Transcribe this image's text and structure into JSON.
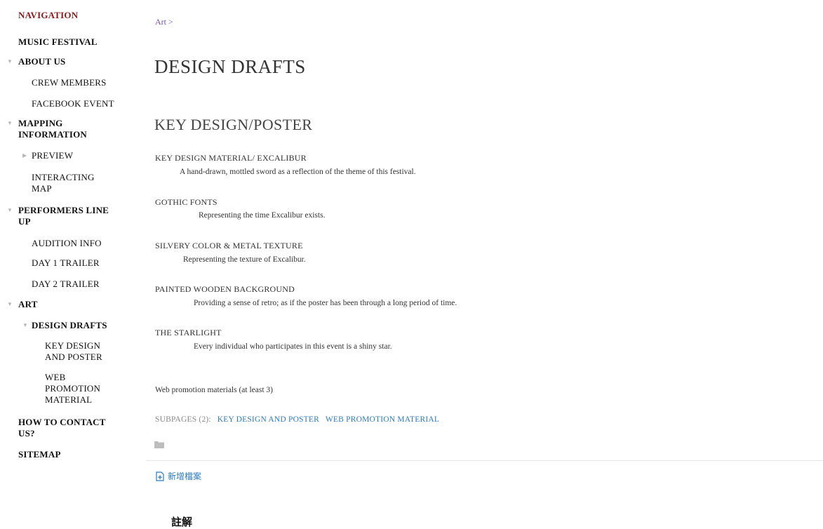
{
  "sidebar": {
    "heading": "NAVIGATION",
    "items": [
      {
        "label": "MUSIC FESTIVAL"
      },
      {
        "label": "ABOUT US"
      },
      {
        "label": "CREW MEMBERS"
      },
      {
        "label": "FACEBOOK EVENT"
      },
      {
        "label_line1": "MAPPING",
        "label_line2": "INFORMATION"
      },
      {
        "label": "PREVIEW"
      },
      {
        "label_line1": "INTERACTING",
        "label_line2": "MAP"
      },
      {
        "label_line1": "PERFORMERS LINE",
        "label_line2": "UP"
      },
      {
        "label": "AUDITION INFO"
      },
      {
        "label": "DAY 1 TRAILER"
      },
      {
        "label": "DAY 2 TRAILER"
      },
      {
        "label": "ART"
      },
      {
        "label": "DESIGN DRAFTS"
      },
      {
        "label_line1": "KEY DESIGN",
        "label_line2": "AND POSTER"
      },
      {
        "label_line1": "WEB",
        "label_line2": "PROMOTION",
        "label_line3": "MATERIAL"
      },
      {
        "label_line1": "HOW TO CONTACT",
        "label_line2": "US?"
      },
      {
        "label": "SITEMAP"
      }
    ]
  },
  "breadcrumb": "Art >",
  "page_title": "DESIGN DRAFTS",
  "section_title": "KEY DESIGN/POSTER",
  "design_items": [
    {
      "title": "KEY DESIGN MATERIAL/ EXCALIBUR",
      "desc": "A hand-drawn, mottled sword as a reflection of the theme of this festival."
    },
    {
      "title": "GOTHIC FONTS",
      "desc": "Representing the time Excalibur exists."
    },
    {
      "title": "SILVERY COLOR & METAL TEXTURE",
      "desc": "Representing the texture of Excalibur."
    },
    {
      "title": "PAINTED WOODEN BACKGROUND",
      "desc": "Providing a sense of retro; as if the poster has been through a long period of time."
    },
    {
      "title": "THE STARLIGHT",
      "desc": "Every individual who participates in this event is a shiny star."
    }
  ],
  "web_promo_text": "Web promotion materials (at least 3)",
  "subpages": {
    "label": "SUBPAGES (2):",
    "links": [
      "KEY DESIGN AND POSTER",
      "WEB PROMOTION MATERIAL"
    ]
  },
  "add_file_label": "新增檔案",
  "comments_title": "註解",
  "colors": {
    "nav_heading": "#8b1a1a",
    "link": "#2b7bc0",
    "breadcrumb": "#7a4fa0"
  }
}
